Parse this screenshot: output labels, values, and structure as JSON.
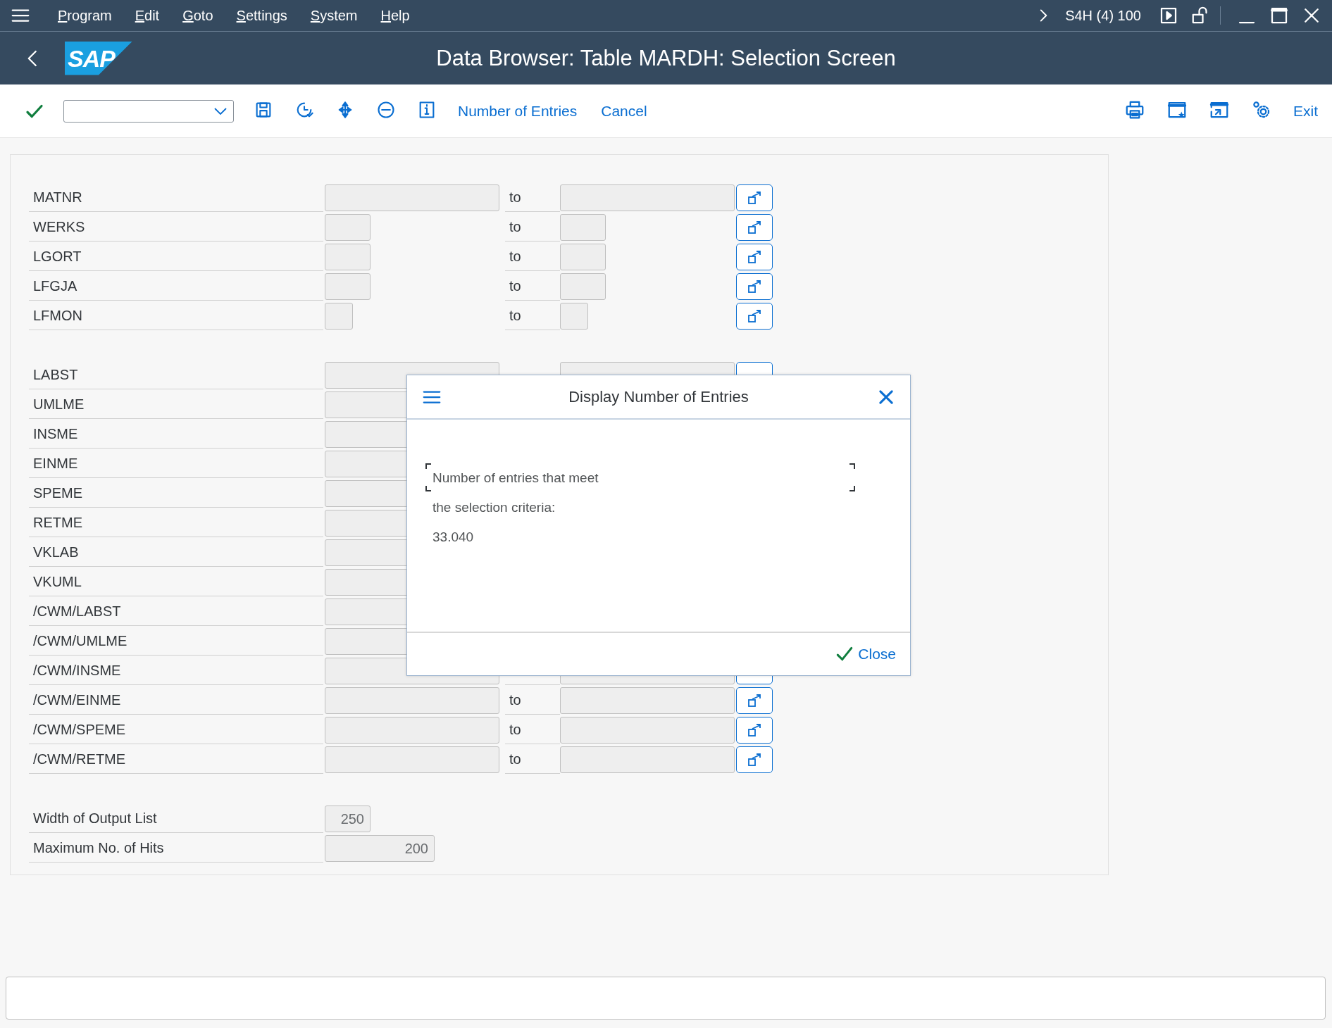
{
  "menu_bar": {
    "items": [
      "Program",
      "Edit",
      "Goto",
      "Settings",
      "System",
      "Help"
    ],
    "system": "S4H (4) 100"
  },
  "title_bar": {
    "logo": "SAP",
    "title": "Data Browser: Table MARDH: Selection Screen"
  },
  "toolbar": {
    "buttons": [
      "Number of Entries",
      "Cancel"
    ],
    "exit": "Exit"
  },
  "selection": {
    "groups": [
      [
        {
          "label": "MATNR",
          "kind": "long",
          "to": "to"
        },
        {
          "label": "WERKS",
          "kind": "short",
          "to": "to"
        },
        {
          "label": "LGORT",
          "kind": "short",
          "to": "to"
        },
        {
          "label": "LFGJA",
          "kind": "short",
          "to": "to"
        },
        {
          "label": "LFMON",
          "kind": "tiny",
          "to": "to"
        }
      ],
      [
        {
          "label": "LABST",
          "kind": "long"
        },
        {
          "label": "UMLME",
          "kind": "covered"
        },
        {
          "label": "INSME",
          "kind": "covered"
        },
        {
          "label": "EINME",
          "kind": "covered"
        },
        {
          "label": "SPEME",
          "kind": "covered"
        },
        {
          "label": "RETME",
          "kind": "covered"
        },
        {
          "label": "VKLAB",
          "kind": "covered"
        },
        {
          "label": "VKUML",
          "kind": "covered"
        },
        {
          "label": "/CWM/LABST",
          "kind": "covered"
        },
        {
          "label": "/CWM/UMLME",
          "kind": "covered"
        },
        {
          "label": "/CWM/INSME",
          "kind": "long"
        },
        {
          "label": "/CWM/EINME",
          "kind": "long",
          "to": "to"
        },
        {
          "label": "/CWM/SPEME",
          "kind": "long",
          "to": "to"
        },
        {
          "label": "/CWM/RETME",
          "kind": "long",
          "to": "to"
        }
      ]
    ],
    "output": [
      {
        "label": "Width of Output List",
        "value": "250",
        "kind": "short"
      },
      {
        "label": "Maximum No. of Hits",
        "value": "200",
        "kind": "medium"
      }
    ]
  },
  "dialog": {
    "title": "Display Number of Entries",
    "lines": [
      "Number of entries that meet",
      "the selection criteria:",
      "33.040"
    ],
    "close": "Close"
  }
}
